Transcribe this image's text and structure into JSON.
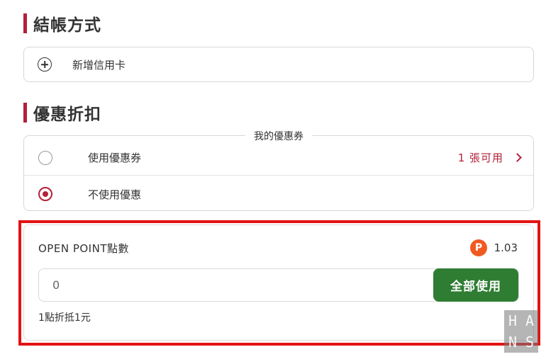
{
  "payment": {
    "title": "結帳方式",
    "add_card_label": "新增信用卡"
  },
  "discount": {
    "title": "優惠折扣",
    "coupon_legend": "我的優惠券",
    "options": [
      {
        "label": "使用優惠券",
        "selected": false,
        "count_text": "1 張可用"
      },
      {
        "label": "不使用優惠",
        "selected": true
      }
    ]
  },
  "points": {
    "title": "OPEN POINT點數",
    "badge_letter": "P",
    "balance": "1.03",
    "input_placeholder": "0",
    "use_all_label": "全部使用",
    "note": "1點折抵1元"
  },
  "watermark": {
    "letters": [
      "H",
      "A",
      "N",
      "S"
    ]
  },
  "colors": {
    "accent_red": "#b3213a",
    "button_green": "#2f7d33",
    "badge_orange": "#f05a22",
    "highlight_red": "#e31212"
  }
}
